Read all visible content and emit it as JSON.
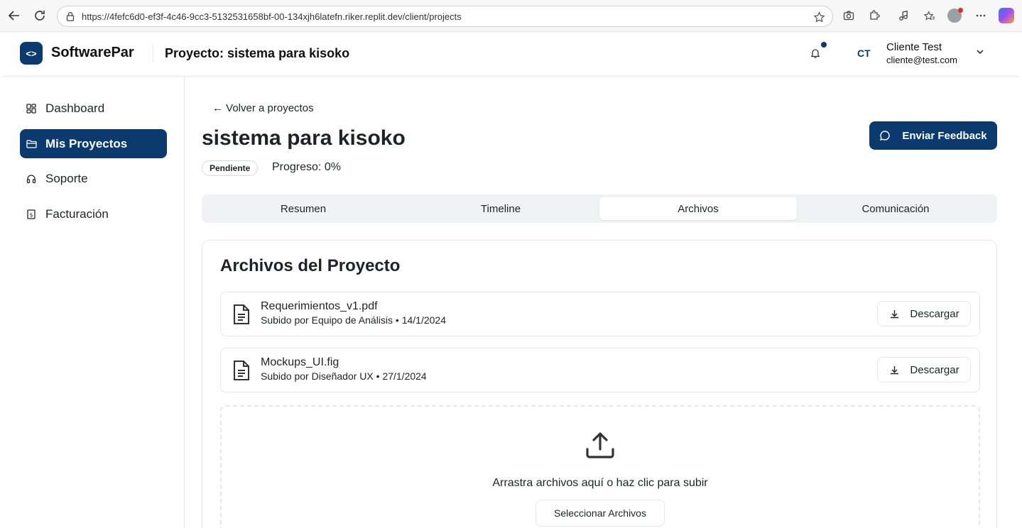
{
  "browser": {
    "url": "https://4fefc6d0-ef3f-4c46-9cc3-5132531658bf-00-134xjh6latefn.riker.replit.dev/client/projects"
  },
  "header": {
    "brand": "SoftwarePar",
    "logo_glyph": "<>",
    "title": "Proyecto: sistema para kisoko",
    "user_initials": "CT",
    "user_name": "Cliente Test",
    "user_email": "cliente@test.com"
  },
  "sidebar": {
    "items": [
      {
        "label": "Dashboard",
        "icon": "dashboard-grid-icon"
      },
      {
        "label": "Mis Proyectos",
        "icon": "folder-icon",
        "active": true
      },
      {
        "label": "Soporte",
        "icon": "headset-icon"
      },
      {
        "label": "Facturación",
        "icon": "invoice-icon"
      }
    ]
  },
  "main": {
    "back_link": "← Volver a proyectos",
    "project_title": "sistema para kisoko",
    "status": "Pendiente",
    "progress": "Progreso: 0%",
    "feedback_button": "Enviar Feedback",
    "tabs": [
      {
        "label": "Resumen"
      },
      {
        "label": "Timeline"
      },
      {
        "label": "Archivos",
        "active": true
      },
      {
        "label": "Comunicación"
      }
    ],
    "files_panel": {
      "title": "Archivos del Proyecto",
      "files": [
        {
          "name": "Requerimientos_v1.pdf",
          "meta": "Subido por Equipo de Análisis • 14/1/2024",
          "action": "Descargar"
        },
        {
          "name": "Mockups_UI.fig",
          "meta": "Subido por Diseñador UX • 27/1/2024",
          "action": "Descargar"
        }
      ],
      "dropzone_text": "Arrastra archivos aquí o haz clic para subir",
      "select_button": "Seleccionar Archivos"
    }
  },
  "colors": {
    "primary": "#0b3a6e",
    "tab_bg": "#f1f2f4",
    "border": "#e5e7eb"
  }
}
